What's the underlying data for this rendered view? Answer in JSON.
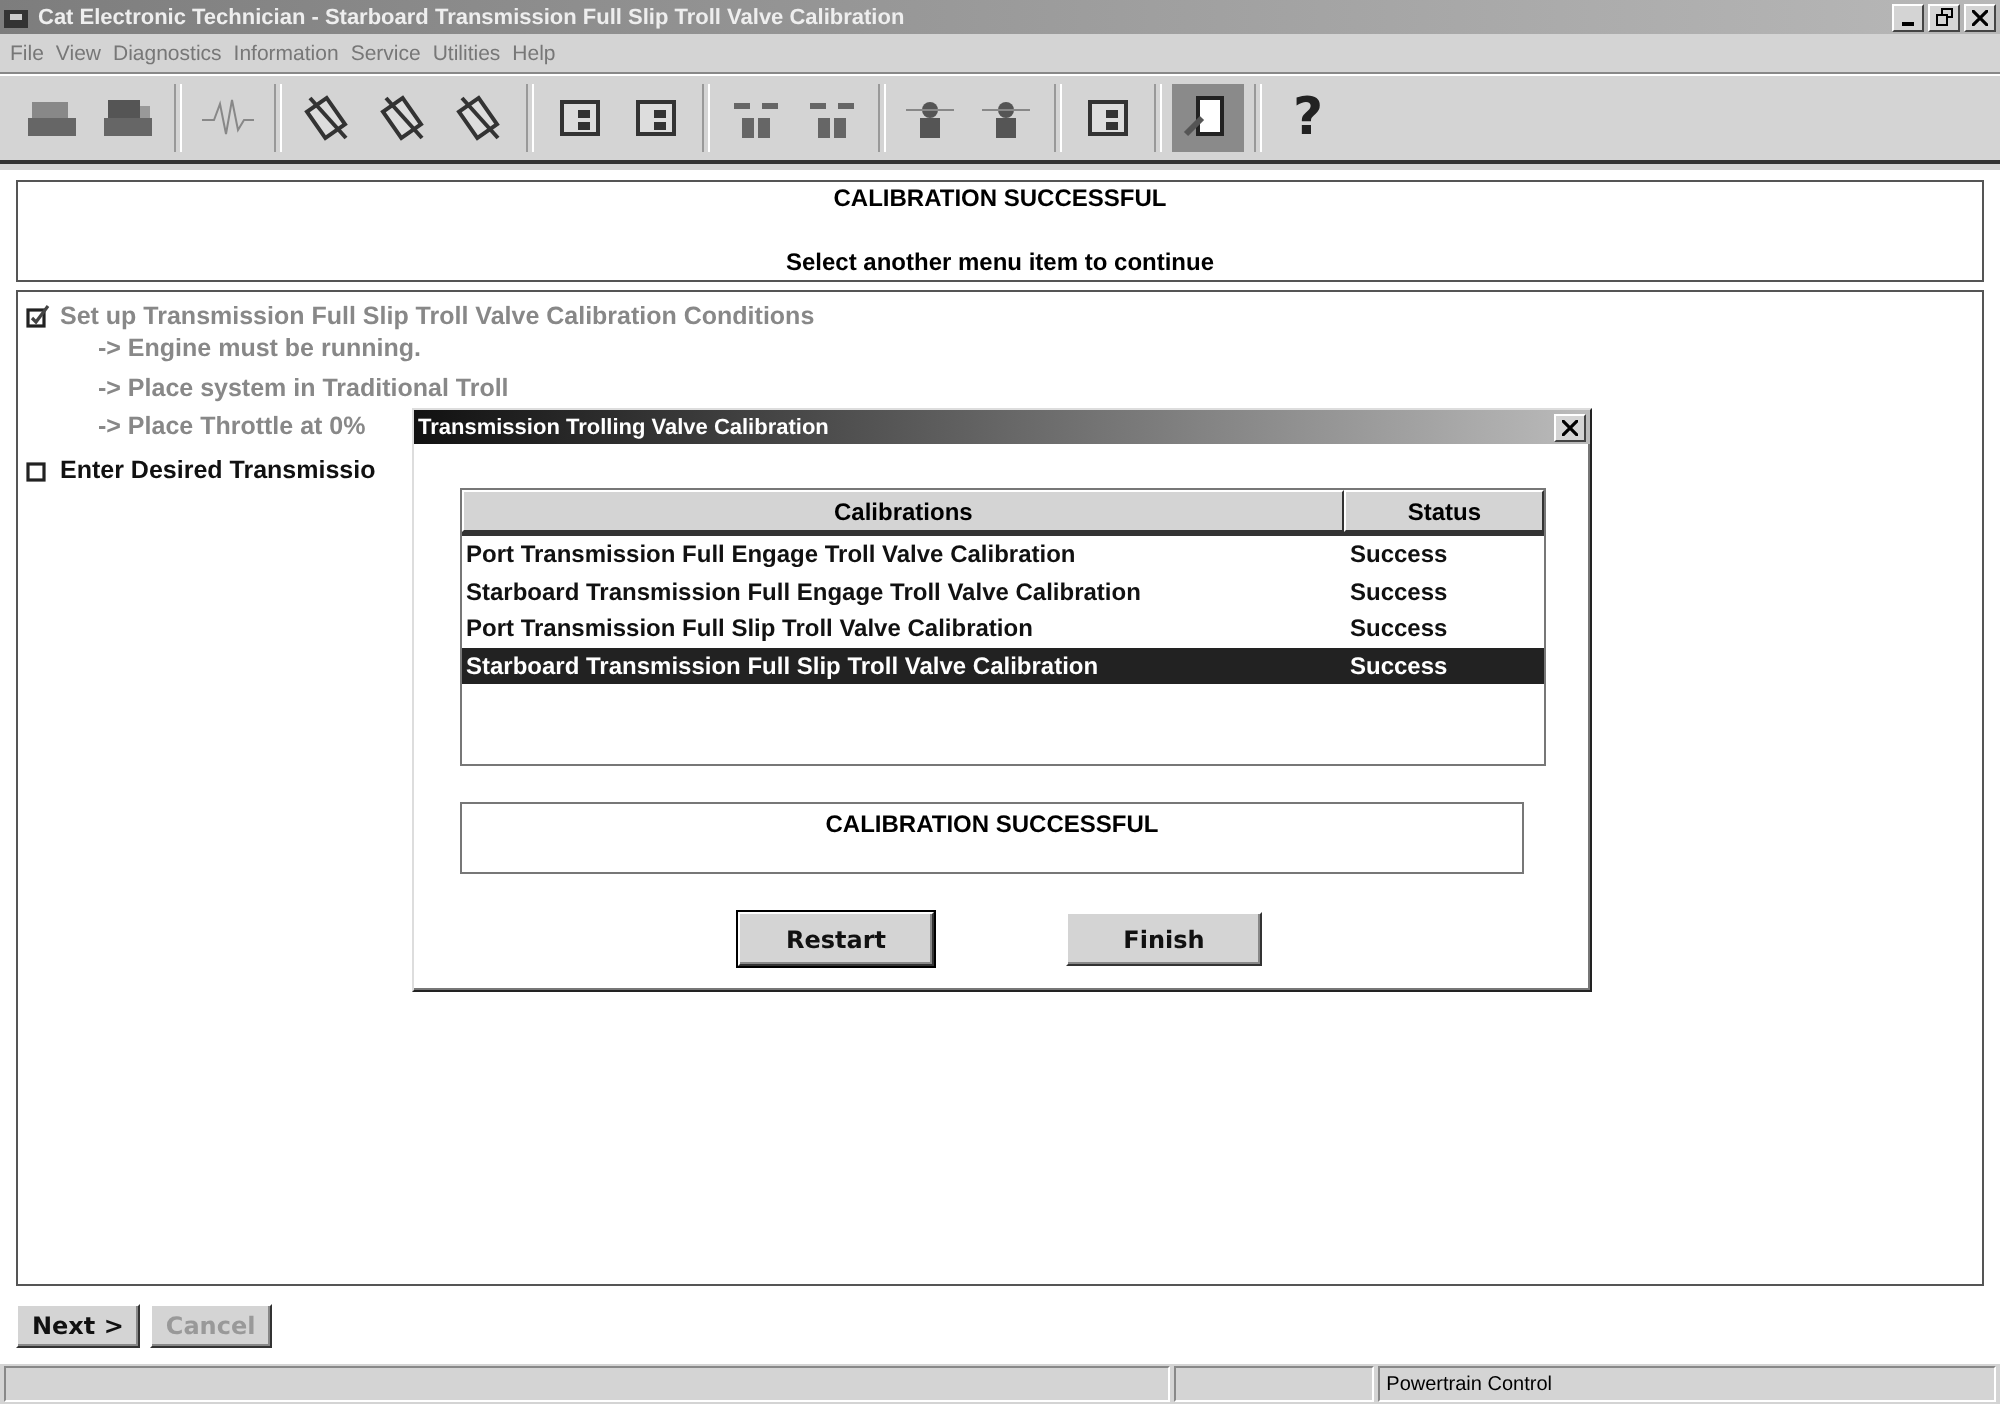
{
  "window": {
    "title": "Cat Electronic Technician - Starboard Transmission Full Slip Troll Valve Calibration"
  },
  "menu": [
    "File",
    "View",
    "Diagnostics",
    "Information",
    "Service",
    "Utilities",
    "Help"
  ],
  "toolbar": [
    {
      "kind": "printer",
      "pressed": false
    },
    {
      "kind": "printer2",
      "pressed": false
    },
    {
      "kind": "sep"
    },
    {
      "kind": "wave",
      "pressed": false
    },
    {
      "kind": "sep"
    },
    {
      "kind": "tool1",
      "pressed": false
    },
    {
      "kind": "tool2",
      "pressed": false
    },
    {
      "kind": "tool3",
      "pressed": false
    },
    {
      "kind": "sep"
    },
    {
      "kind": "module1",
      "pressed": false
    },
    {
      "kind": "module2",
      "pressed": false
    },
    {
      "kind": "sep"
    },
    {
      "kind": "connect",
      "pressed": false
    },
    {
      "kind": "disconnect",
      "pressed": false
    },
    {
      "kind": "sep"
    },
    {
      "kind": "person1",
      "pressed": false
    },
    {
      "kind": "person2",
      "pressed": false
    },
    {
      "kind": "sep"
    },
    {
      "kind": "module3",
      "pressed": false
    },
    {
      "kind": "sep"
    },
    {
      "kind": "door",
      "pressed": true
    },
    {
      "kind": "sep"
    },
    {
      "kind": "help",
      "label": "?",
      "pressed": false
    }
  ],
  "banner": {
    "title": "CALIBRATION SUCCESSFUL",
    "message": "Select another menu item to continue"
  },
  "steps": [
    {
      "label": "Set up Transmission Full Slip Troll Valve Calibration Conditions",
      "checked": true,
      "disabled": true,
      "children": [
        {
          "label": "-> Engine must be running."
        },
        {
          "label": "-> Place system in Traditional Troll"
        },
        {
          "label": "-> Place Throttle at 0%"
        }
      ]
    },
    {
      "label": "Enter Desired Transmissio",
      "checked": false,
      "disabled": false
    }
  ],
  "dialog": {
    "title": "Transmission Trolling Valve Calibration",
    "columns": [
      "Calibrations",
      "Status"
    ],
    "rows": [
      {
        "name": "Port Transmission Full Engage Troll Valve Calibration",
        "status": "Success",
        "selected": false
      },
      {
        "name": "Starboard Transmission Full Engage Troll Valve Calibration",
        "status": "Success",
        "selected": false
      },
      {
        "name": "Port Transmission Full Slip Troll Valve Calibration",
        "status": "Success",
        "selected": false
      },
      {
        "name": "Starboard Transmission Full Slip Troll Valve Calibration",
        "status": "Success",
        "selected": true
      }
    ],
    "message": "CALIBRATION SUCCESSFUL",
    "buttons": [
      {
        "label": "Restart",
        "default": true
      },
      {
        "label": "Finish",
        "default": false
      }
    ]
  },
  "buttons": [
    {
      "label": "Next >",
      "disabled": false
    },
    {
      "label": "Cancel",
      "disabled": true
    }
  ],
  "status_bar": [
    "Powertrain Control"
  ]
}
